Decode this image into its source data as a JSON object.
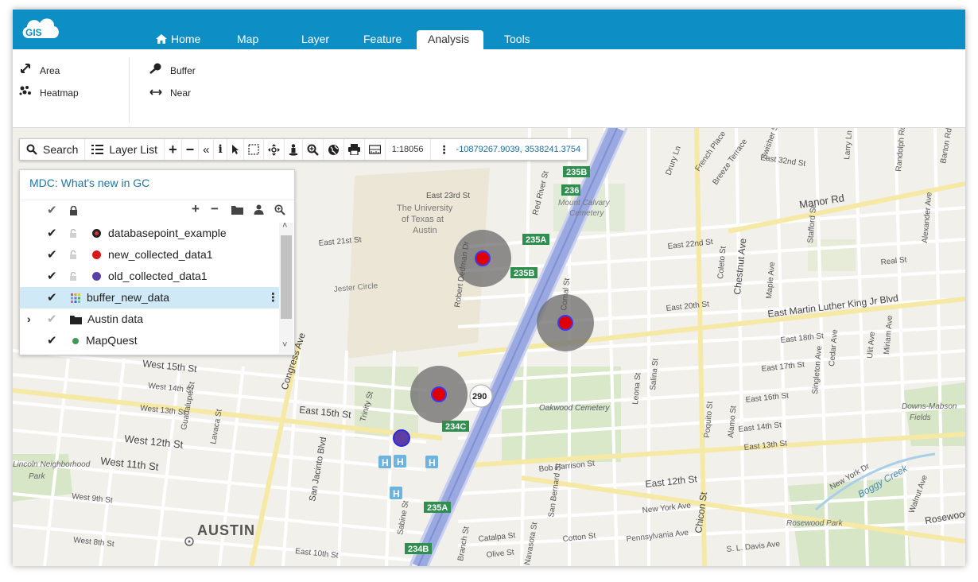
{
  "app": {
    "logo_text": "GIS"
  },
  "nav": {
    "tabs": [
      {
        "label": "Home",
        "active": false
      },
      {
        "label": "Map",
        "active": false
      },
      {
        "label": "Layer",
        "active": false
      },
      {
        "label": "Feature",
        "active": false
      },
      {
        "label": "Analysis",
        "active": true
      },
      {
        "label": "Tools",
        "active": false
      }
    ]
  },
  "ribbon": {
    "groups": [
      [
        {
          "label": "Area",
          "icon": "expand-arrows-icon"
        },
        {
          "label": "Heatmap",
          "icon": "heatmap-icon"
        }
      ],
      [
        {
          "label": "Buffer",
          "icon": "buffer-icon"
        },
        {
          "label": "Near",
          "icon": "near-arrows-icon"
        }
      ]
    ]
  },
  "toolbar": {
    "search_label": "Search",
    "layer_list_label": "Layer List",
    "scale": "1:18056",
    "coordinates": "-10879267.9039, 3538241.3754"
  },
  "layer_panel": {
    "title": "MDC: What's new in GC",
    "layers": [
      {
        "name": "databasepoint_example",
        "checked": true,
        "locked": true,
        "symbol_color": "#e0322a",
        "symbol_style": "ring"
      },
      {
        "name": "new_collected_data1",
        "checked": true,
        "locked": true,
        "symbol_color": "#d91818"
      },
      {
        "name": "old_collected_data1",
        "checked": true,
        "locked": true,
        "symbol_color": "#5b3fa8"
      },
      {
        "name": "buffer_new_data",
        "checked": true,
        "locked": false,
        "symbol": "grid",
        "selected": true
      },
      {
        "name": "Austin data",
        "checked": false,
        "folder": true
      },
      {
        "name": "MapQuest",
        "checked": true,
        "symbol_color": "#3c9b55"
      }
    ]
  },
  "map": {
    "labels": [
      {
        "text": "AUSTIN",
        "kind": "city"
      },
      {
        "text": "East 23rd St"
      },
      {
        "text": "The University"
      },
      {
        "text": "of Texas at"
      },
      {
        "text": "Austin"
      },
      {
        "text": "Red River St"
      },
      {
        "text": "Mount Calvary"
      },
      {
        "text": "Cemetery"
      },
      {
        "text": "Manor Rd"
      },
      {
        "text": "East 22nd St"
      },
      {
        "text": "East 21st St"
      },
      {
        "text": "Real St"
      },
      {
        "text": "East Martin Luther King Jr Blvd"
      },
      {
        "text": "East 20th St"
      },
      {
        "text": "East 18th St"
      },
      {
        "text": "East 17th St"
      },
      {
        "text": "East 16th St"
      },
      {
        "text": "East 14th St"
      },
      {
        "text": "East 13th St"
      },
      {
        "text": "Oakwood Cemetery"
      },
      {
        "text": "East 12th St"
      },
      {
        "text": "Chicon St"
      },
      {
        "text": "New York Ave"
      },
      {
        "text": "Pennsylvania Ave"
      },
      {
        "text": "S. L. Davis Ave"
      },
      {
        "text": "Rosewood Park"
      },
      {
        "text": "Boggy Creek"
      },
      {
        "text": "Downs-Mabson"
      },
      {
        "text": "Fields"
      },
      {
        "text": "West 15th St"
      },
      {
        "text": "West 14th St"
      },
      {
        "text": "West 13th St"
      },
      {
        "text": "West 12th St"
      },
      {
        "text": "West 11th St"
      },
      {
        "text": "West 9th St"
      },
      {
        "text": "West 8th St"
      },
      {
        "text": "East 15th St"
      },
      {
        "text": "East 10th St"
      },
      {
        "text": "Congress Ave"
      },
      {
        "text": "San Jacinto Blvd"
      },
      {
        "text": "Trinity St"
      },
      {
        "text": "Guadalupe St"
      },
      {
        "text": "Lavaca St"
      },
      {
        "text": "Jester Circle"
      },
      {
        "text": "Comal St"
      },
      {
        "text": "Chestnut Ave"
      },
      {
        "text": "Bob Harrison St"
      },
      {
        "text": "Cotton St"
      },
      {
        "text": "Catalpa St"
      },
      {
        "text": "Olive St"
      },
      {
        "text": "Sabine St"
      },
      {
        "text": "Navasota St"
      },
      {
        "text": "Branch St"
      },
      {
        "text": "San Bernard St"
      },
      {
        "text": "Leona St"
      },
      {
        "text": "Salina St"
      },
      {
        "text": "Poquito St"
      },
      {
        "text": "Alamo St"
      },
      {
        "text": "Miriam Ave"
      },
      {
        "text": "Cedar Ave"
      },
      {
        "text": "Walnut Ave"
      },
      {
        "text": "New York Dr"
      },
      {
        "text": "East 32nd St"
      },
      {
        "text": "Randolph Rd"
      },
      {
        "text": "Swisher St"
      },
      {
        "text": "Breeze Terrace"
      },
      {
        "text": "French Place"
      },
      {
        "text": "Drury Ln"
      },
      {
        "text": "Barton Rd"
      },
      {
        "text": "Larry Ln"
      },
      {
        "text": "Alexander Ave"
      },
      {
        "text": "Stafford St"
      },
      {
        "text": "Singleton Ave"
      },
      {
        "text": "Ulit Ave"
      },
      {
        "text": "Coleto St"
      },
      {
        "text": "Maple Ave"
      },
      {
        "text": "Lincoln Neighborhood"
      },
      {
        "text": "Park"
      },
      {
        "text": "Robert Dedman Dr"
      },
      {
        "text": "Rosewood"
      }
    ],
    "shields": [
      "235B",
      "236",
      "235A",
      "235B",
      "290",
      "234C",
      "235A",
      "234B"
    ],
    "buffer_points": [
      {
        "lon": -97.7265,
        "lat": 30.2855
      },
      {
        "lon": -97.7192,
        "lat": 30.2818
      },
      {
        "lon": -97.7302,
        "lat": 30.2754
      }
    ],
    "old_point": {
      "lon": -97.7335,
      "lat": 30.2718
    },
    "buffer_fill": "#6b6b6b",
    "point_color": "#e00000",
    "point_outline": "#3a3af0",
    "old_point_color": "#5e3ea4"
  }
}
